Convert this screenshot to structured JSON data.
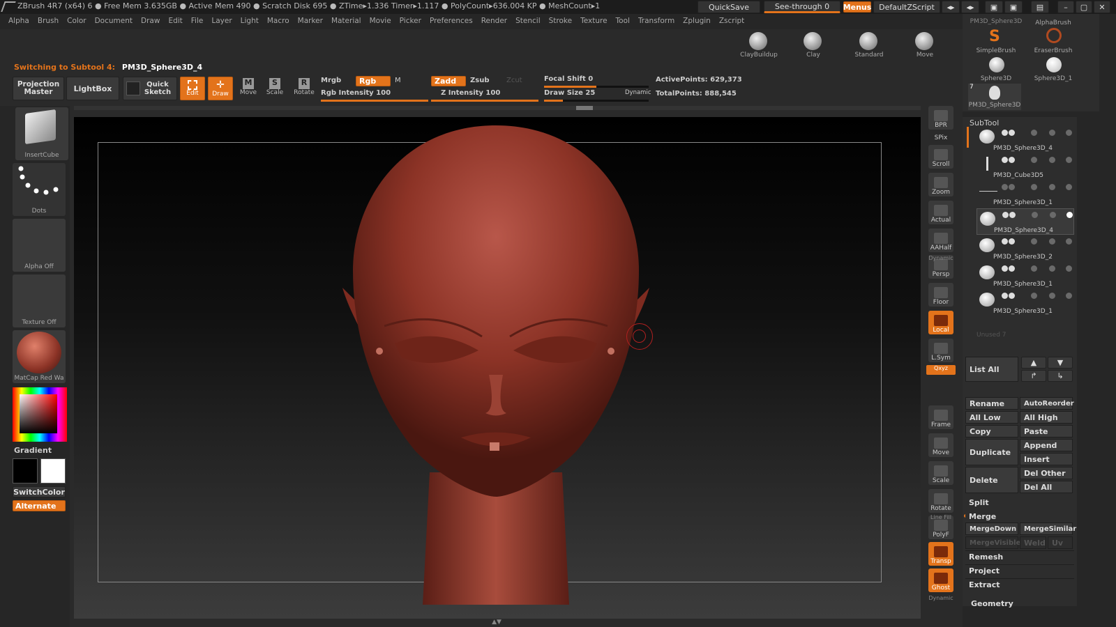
{
  "titlebar": {
    "text": "ZBrush 4R7 (x64)   6   ● Free Mem 3.635GB ● Active Mem 490 ● Scratch Disk 695 ● ZTime▸1.336 Timer▸1.117 ● PolyCount▸636.004 KP ● MeshCount▸1",
    "quicksave": "QuickSave",
    "seethrough": "See-through  0",
    "menus": "Menus",
    "defaultzscript": "DefaultZScript"
  },
  "menubar": [
    "Alpha",
    "Brush",
    "Color",
    "Document",
    "Draw",
    "Edit",
    "File",
    "Layer",
    "Light",
    "Macro",
    "Marker",
    "Material",
    "Movie",
    "Picker",
    "Preferences",
    "Render",
    "Stencil",
    "Stroke",
    "Texture",
    "Tool",
    "Transform",
    "Zplugin",
    "Zscript"
  ],
  "status": {
    "label": "Switching to Subtool 4:",
    "value": "PM3D_Sphere3D_4"
  },
  "brushes": [
    "ClayBuildup",
    "Clay",
    "Standard",
    "Move"
  ],
  "toolbar": {
    "projection": "Projection Master",
    "lightbox": "LightBox",
    "quicksketch": "Quick Sketch",
    "edit": "Edit",
    "draw": "Draw",
    "move": "Move",
    "scale": "Scale",
    "rotate": "Rotate",
    "mrgb": "Mrgb",
    "rgb": "Rgb",
    "m": "M",
    "rgbint": "Rgb  Intensity 100",
    "zadd": "Zadd",
    "zsub": "Zsub",
    "zcut": "Zcut",
    "zint": "Z  Intensity 100",
    "focal": "Focal  Shift 0",
    "drawsize": "Draw  Size 25",
    "dynamic": "Dynamic",
    "active": "ActivePoints: 629,373",
    "total": "TotalPoints: 888,545"
  },
  "left": {
    "insertcube": "InsertCube",
    "dots": "Dots",
    "alpha": "Alpha  Off",
    "texture": "Texture  Off",
    "matcap": "MatCap  Red  Wa",
    "gradient": "Gradient",
    "switchcolor": "SwitchColor",
    "alternate": "Alternate"
  },
  "shelf": [
    "BPR",
    "SPix",
    "Scroll",
    "Zoom",
    "Actual",
    "AAHalf",
    "Persp",
    "Floor",
    "Local",
    "L.Sym",
    "Frame",
    "Move",
    "Scale",
    "Rotate",
    "PolyF",
    "Transp",
    "Ghost"
  ],
  "shelfsmall": {
    "dynamic": "Dynamic",
    "xyz": "Qxyz",
    "linefill": "Line Fill",
    "dynamic2": "Dynamic"
  },
  "tools": {
    "top": "PM3D_Sphere3D",
    "alphabrush": "AlphaBrush",
    "simplebrush": "SimpleBrush",
    "eraserbrush": "EraserBrush",
    "sphere3d": "Sphere3D",
    "sphere3d1": "Sphere3D_1",
    "num": "7",
    "pm3d": "PM3D_Sphere3D"
  },
  "subtool": {
    "header": "SubTool",
    "items": [
      "PM3D_Sphere3D_4",
      "PM3D_Cube3D5",
      "PM3D_Sphere3D_1",
      "PM3D_Sphere3D_4",
      "PM3D_Sphere3D_2",
      "PM3D_Sphere3D_1",
      "PM3D_Sphere3D_1"
    ],
    "unused": "Unused  7",
    "listall": "List  All",
    "rename": "Rename",
    "autoreorder": "AutoReorder",
    "alllow": "All  Low",
    "allhigh": "All  High",
    "copy": "Copy",
    "paste": "Paste",
    "duplicate": "Duplicate",
    "append": "Append",
    "insert": "Insert",
    "delete": "Delete",
    "delother": "Del  Other",
    "delall": "Del  All",
    "split": "Split",
    "merge": "Merge",
    "mergedown": "MergeDown",
    "mergesimilar": "MergeSimilar",
    "mergevisible": "MergeVisible",
    "weld": "Weld",
    "uv": "Uv",
    "remesh": "Remesh",
    "project": "Project",
    "extract": "Extract",
    "geometry": "Geometry"
  },
  "colors": {
    "accent": "#e3731b",
    "model": "#8c3326"
  }
}
